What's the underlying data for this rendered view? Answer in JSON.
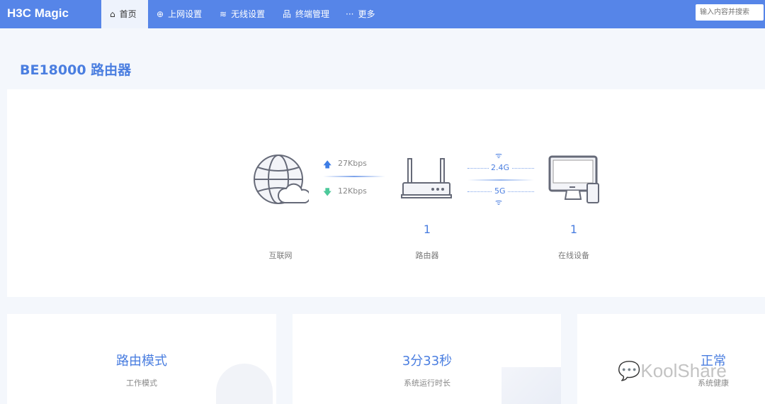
{
  "nav": {
    "logo": "H3C Magic",
    "items": [
      {
        "label": "首页",
        "icon": "home-icon"
      },
      {
        "label": "上网设置",
        "icon": "globe-icon"
      },
      {
        "label": "无线设置",
        "icon": "wifi-icon"
      },
      {
        "label": "终端管理",
        "icon": "network-icon"
      },
      {
        "label": "更多",
        "icon": "more-icon"
      }
    ],
    "search_placeholder": "输入内容并搜索"
  },
  "page": {
    "title": "BE18000 路由器"
  },
  "topology": {
    "upload": "27Kbps",
    "download": "12Kbps",
    "band1": "2.4G",
    "band2": "5G",
    "internet_label": "互联网",
    "router_count": "1",
    "router_label": "路由器",
    "device_count": "1",
    "device_label": "在线设备"
  },
  "cards": [
    {
      "value": "路由模式",
      "label": "工作模式"
    },
    {
      "value": "3分33秒",
      "label": "系统运行时长"
    },
    {
      "value": "正常",
      "label": "系统健康"
    }
  ],
  "watermark": "KoolShare",
  "colors": {
    "nav": "#5685e8",
    "accent": "#4a7ee0",
    "up": "#3d7de6",
    "down": "#4cc99a"
  }
}
